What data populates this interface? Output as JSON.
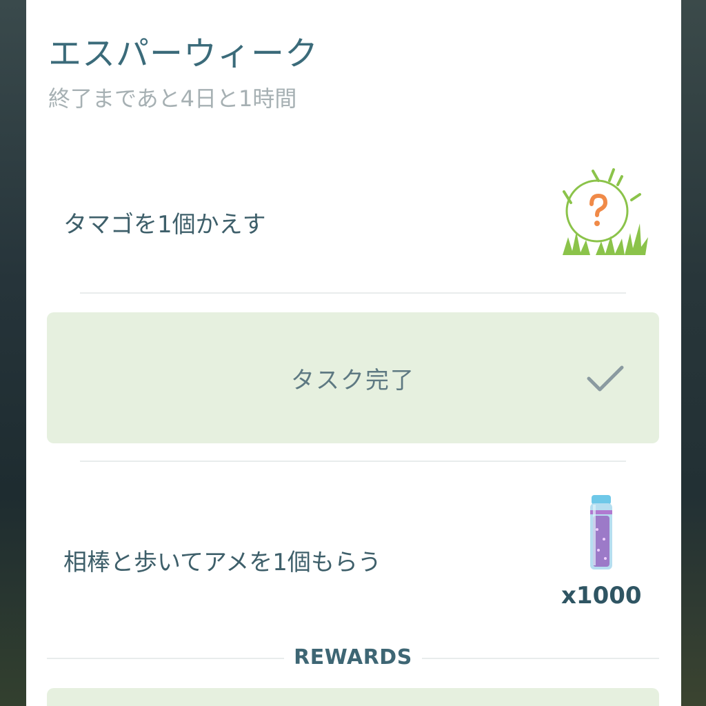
{
  "research": {
    "title": "エスパーウィーク",
    "time_remaining": "終了まであと4日と1時間"
  },
  "tasks": [
    {
      "label": "タマゴを1個かえす",
      "reward_icon": "mystery-egg-grass-icon",
      "status": "completed"
    },
    {
      "label": "相棒と歩いてアメを1個もらう",
      "reward_icon": "stardust-potion-icon",
      "reward_quantity": "x1000"
    }
  ],
  "completed_banner": {
    "label": "タスク完了",
    "icon": "checkmark-icon"
  },
  "rewards_section": {
    "label": "REWARDS"
  },
  "colors": {
    "title": "#3b6b7a",
    "completed_bg": "#e6f0df",
    "egg_grass": "#8bc34a",
    "question_mark": "#f08a48"
  }
}
